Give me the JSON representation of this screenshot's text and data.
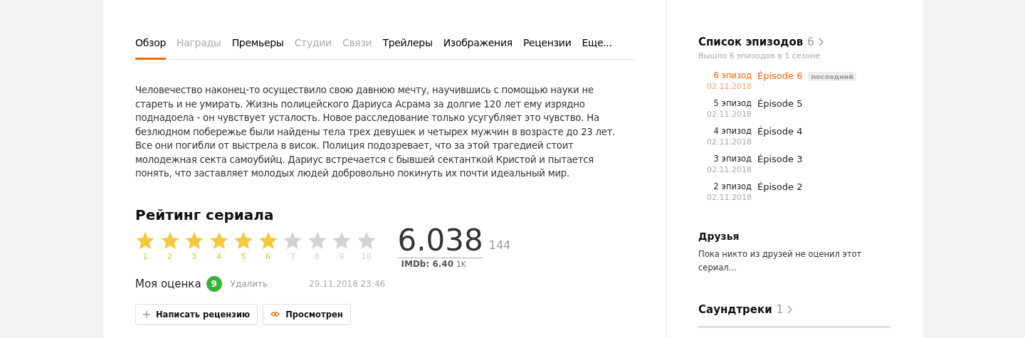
{
  "tabs": [
    {
      "label": "Обзор",
      "selected": true,
      "disabled": false
    },
    {
      "label": "Награды",
      "selected": false,
      "disabled": true
    },
    {
      "label": "Премьеры",
      "selected": false,
      "disabled": false
    },
    {
      "label": "Студии",
      "selected": false,
      "disabled": true
    },
    {
      "label": "Связи",
      "selected": false,
      "disabled": true
    },
    {
      "label": "Трейлеры",
      "selected": false,
      "disabled": false
    },
    {
      "label": "Изображения",
      "selected": false,
      "disabled": false
    },
    {
      "label": "Рецензии",
      "selected": false,
      "disabled": false
    },
    {
      "label": "Еще...",
      "selected": false,
      "disabled": false
    }
  ],
  "description": "Человечество наконец-то осуществило свою давнюю мечту, научившись с помощью науки не стареть и не умирать. Жизнь полицейского Дариуса Асрама за долгие 120 лет ему изрядно поднадоела - он чувствует усталость. Новое расследование только усугубляет это чувство. На безлюдном побережье были найдены тела трех девушек и четырех мужчин в возрасте до 23 лет. Все они погибли от выстрела в висок. Полиция подозревает, что за этой трагедией стоит молодежная секта самоубийц. Дариус встречается с бывшей сектанткой Кристой и пытается понять, что заставляет молодых людей добровольно покинуть их почти идеальный мир.",
  "rating": {
    "title": "Рейтинг сериала",
    "stars": 6,
    "star_labels": [
      "1",
      "2",
      "3",
      "4",
      "5",
      "6",
      "7",
      "8",
      "9",
      "10"
    ],
    "score": "6.038",
    "votes": "144",
    "imdb_label": "IMDb: 6.40",
    "imdb_votes": "1K",
    "my_rating_label": "Моя оценка",
    "my_rating": "9",
    "delete": "Удалить",
    "date": "29.11.2018 23:46"
  },
  "buttons": [
    {
      "kind": "plus",
      "label": "Написать рецензию"
    },
    {
      "kind": "eye",
      "label": "Просмотрен"
    }
  ],
  "episodes": {
    "title": "Список эпизодов",
    "count": "6",
    "subtitle": "Вышло 6 эпизодов в 1 сезоне",
    "items": [
      {
        "number": "6 эпизод",
        "date": "02.11.2018",
        "name": "Épisode 6",
        "badge": "последний",
        "current": true
      },
      {
        "number": "5 эпизод",
        "date": "02.11.2018",
        "name": "Épisode 5",
        "current": false
      },
      {
        "number": "4 эпизод",
        "date": "02.11.2018",
        "name": "Épisode 4",
        "current": false
      },
      {
        "number": "3 эпизод",
        "date": "02.11.2018",
        "name": "Épisode 3",
        "current": false
      },
      {
        "number": "2 эпизод",
        "date": "02.11.2018",
        "name": "Épisode 2",
        "current": false
      }
    ]
  },
  "friends": {
    "title": "Друзья",
    "text": "Пока никто из друзей не оценил этот сериал..."
  },
  "soundtracks": {
    "title": "Саундтреки",
    "count": "1"
  }
}
